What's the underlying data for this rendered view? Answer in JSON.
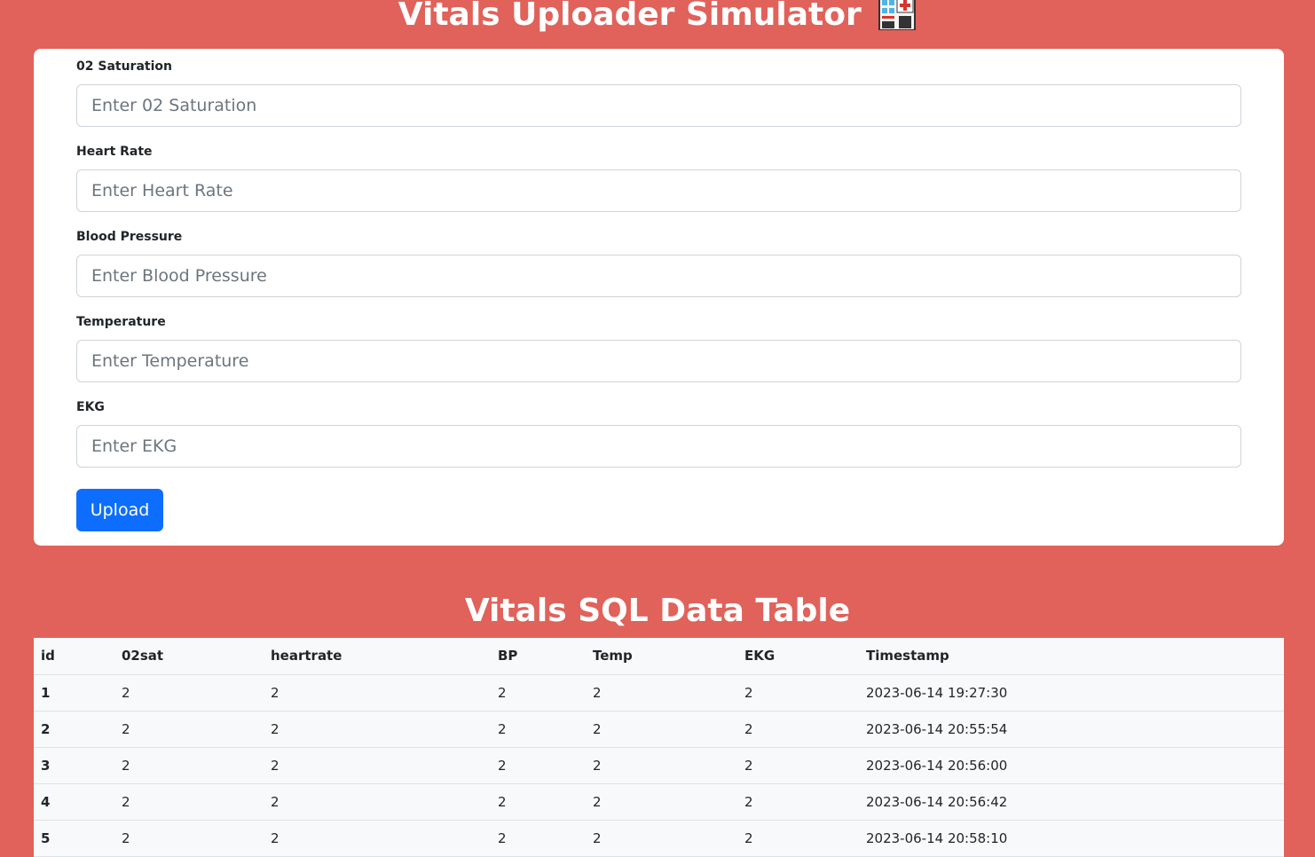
{
  "header": {
    "title": "Vitals Uploader Simulator"
  },
  "form": {
    "fields": [
      {
        "label": "02 Saturation",
        "placeholder": "Enter 02 Saturation",
        "value": ""
      },
      {
        "label": "Heart Rate",
        "placeholder": "Enter Heart Rate",
        "value": ""
      },
      {
        "label": "Blood Pressure",
        "placeholder": "Enter Blood Pressure",
        "value": ""
      },
      {
        "label": "Temperature",
        "placeholder": "Enter Temperature",
        "value": ""
      },
      {
        "label": "EKG",
        "placeholder": "Enter EKG",
        "value": ""
      }
    ],
    "upload_label": "Upload"
  },
  "table": {
    "title": "Vitals SQL Data Table",
    "columns": [
      "id",
      "02sat",
      "heartrate",
      "BP",
      "Temp",
      "EKG",
      "Timestamp"
    ],
    "rows": [
      [
        "1",
        "2",
        "2",
        "2",
        "2",
        "2",
        "2023-06-14 19:27:30"
      ],
      [
        "2",
        "2",
        "2",
        "2",
        "2",
        "2",
        "2023-06-14 20:55:54"
      ],
      [
        "3",
        "2",
        "2",
        "2",
        "2",
        "2",
        "2023-06-14 20:56:00"
      ],
      [
        "4",
        "2",
        "2",
        "2",
        "2",
        "2",
        "2023-06-14 20:56:42"
      ],
      [
        "5",
        "2",
        "2",
        "2",
        "2",
        "2",
        "2023-06-14 20:58:10"
      ]
    ]
  },
  "colors": {
    "background": "#e0625a",
    "primary_button": "#0d6efd",
    "card": "#ffffff"
  },
  "icons": {
    "title_icon": "hospital-icon"
  }
}
